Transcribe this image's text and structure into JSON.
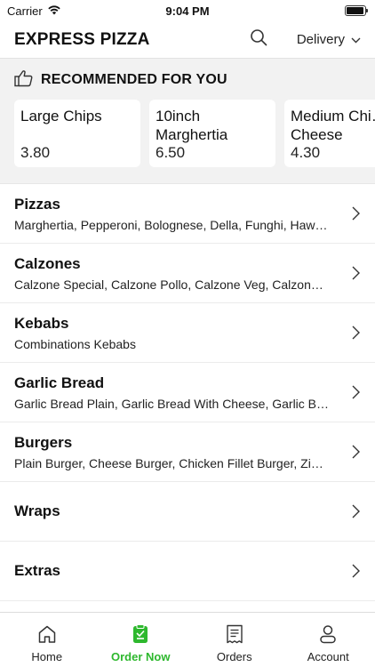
{
  "status": {
    "carrier": "Carrier",
    "time": "9:04 PM",
    "battery_level": 0.95
  },
  "header": {
    "title": "EXPRESS PIZZA",
    "mode": "Delivery"
  },
  "recommended": {
    "title": "RECOMMENDED FOR YOU",
    "items": [
      {
        "name": "Large Chips",
        "price": "3.80"
      },
      {
        "name": "10inch Marghertia",
        "price": "6.50"
      },
      {
        "name": "Medium Chi… Cheese",
        "price": "4.30"
      }
    ]
  },
  "categories": [
    {
      "name": "Pizzas",
      "items": "Marghertia, Pepperoni, Bolognese, Della, Funghi, Haw…"
    },
    {
      "name": "Calzones",
      "items": "Calzone Special, Calzone Pollo, Calzone Veg, Calzone…"
    },
    {
      "name": "Kebabs",
      "items": "Combinations Kebabs"
    },
    {
      "name": "Garlic Bread",
      "items": "Garlic Bread Plain, Garlic Bread With Cheese, Garlic B…"
    },
    {
      "name": "Burgers",
      "items": "Plain Burger, Cheese Burger, Chicken Fillet Burger, Zin…"
    },
    {
      "name": "Wraps",
      "items": ""
    },
    {
      "name": "Extras",
      "items": ""
    }
  ],
  "tabs": [
    {
      "label": "Home",
      "icon": "home-icon"
    },
    {
      "label": "Order Now",
      "icon": "order-icon",
      "active": true
    },
    {
      "label": "Orders",
      "icon": "receipt-icon"
    },
    {
      "label": "Account",
      "icon": "person-icon"
    }
  ],
  "colors": {
    "accent": "#2eb82e",
    "section_bg": "#f2f2f2"
  }
}
